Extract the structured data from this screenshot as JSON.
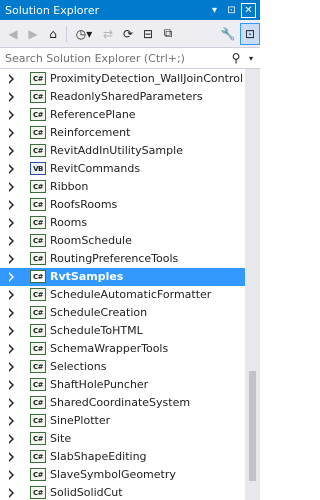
{
  "window": {
    "title": "Solution Explorer",
    "pin_glyph": "▾",
    "pin2_glyph": "⊡",
    "close_glyph": "✕"
  },
  "toolbar": {
    "back": "◀",
    "forward": "▶",
    "home": "⌂",
    "history": "◷▾",
    "sync": "⇄",
    "refresh": "⟳",
    "collapse": "⊟",
    "showall": "⧉",
    "wrench": "🔧",
    "preview": "⊡"
  },
  "search": {
    "placeholder": "Search Solution Explorer (Ctrl+;)",
    "icon": "⚲",
    "dropdown": "▾"
  },
  "tree": {
    "items": [
      {
        "label": "ProximityDetection_WallJoinControl",
        "badge": "C#"
      },
      {
        "label": "ReadonlySharedParameters",
        "badge": "C#"
      },
      {
        "label": "ReferencePlane",
        "badge": "C#"
      },
      {
        "label": "Reinforcement",
        "badge": "C#"
      },
      {
        "label": "RevitAddInUtilitySample",
        "badge": "C#"
      },
      {
        "label": "RevitCommands",
        "badge": "VB"
      },
      {
        "label": "Ribbon",
        "badge": "C#"
      },
      {
        "label": "RoofsRooms",
        "badge": "C#"
      },
      {
        "label": "Rooms",
        "badge": "C#"
      },
      {
        "label": "RoomSchedule",
        "badge": "C#"
      },
      {
        "label": "RoutingPreferenceTools",
        "badge": "C#"
      },
      {
        "label": "RvtSamples",
        "badge": "C#",
        "selected": true
      },
      {
        "label": "ScheduleAutomaticFormatter",
        "badge": "C#"
      },
      {
        "label": "ScheduleCreation",
        "badge": "C#"
      },
      {
        "label": "ScheduleToHTML",
        "badge": "C#"
      },
      {
        "label": "SchemaWrapperTools",
        "badge": "C#"
      },
      {
        "label": "Selections",
        "badge": "C#"
      },
      {
        "label": "ShaftHolePuncher",
        "badge": "C#"
      },
      {
        "label": "SharedCoordinateSystem",
        "badge": "C#"
      },
      {
        "label": "SinePlotter",
        "badge": "C#"
      },
      {
        "label": "Site",
        "badge": "C#"
      },
      {
        "label": "SlabShapeEditing",
        "badge": "C#"
      },
      {
        "label": "SlaveSymbolGeometry",
        "badge": "C#"
      },
      {
        "label": "SolidSolidCut",
        "badge": "C#"
      }
    ]
  },
  "colors": {
    "accent": "#007acc",
    "selection": "#3399ff"
  }
}
